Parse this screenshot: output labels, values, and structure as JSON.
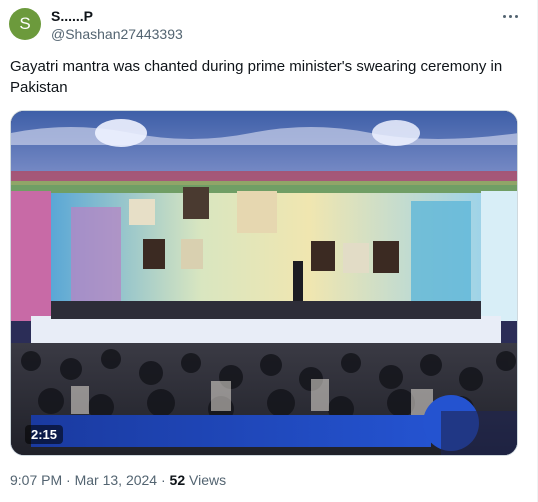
{
  "author": {
    "initial": "S",
    "display_name": "S......P",
    "handle": "@Shashan27443393",
    "avatar_color": "#6c9a3c"
  },
  "tweet": {
    "text": "Gayatri mantra was chanted during prime minister's swearing ceremony in Pakistan"
  },
  "video": {
    "duration": "2:15"
  },
  "meta": {
    "time": "9:07 PM",
    "separator1": " · ",
    "date": "Mar 13, 2024",
    "separator2": " · ",
    "views_count": "52",
    "views_label": " Views"
  },
  "icons": {
    "more": "more-horizontal-icon"
  },
  "colors": {
    "text": "#0f1419",
    "secondary": "#536471",
    "border": "#cfd9de"
  }
}
